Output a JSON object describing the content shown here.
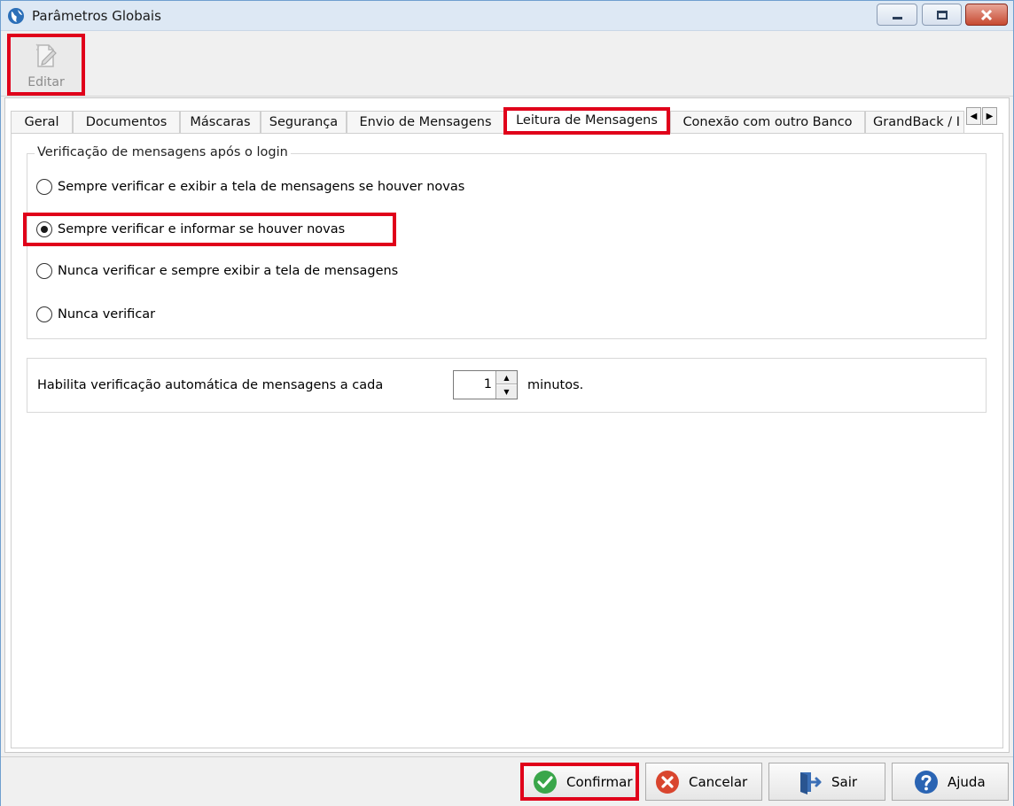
{
  "window": {
    "title": "Parâmetros Globais",
    "colors": {
      "highlight": "#e0001a",
      "titlebar": "#dde8f4"
    }
  },
  "toolbar": {
    "edit_label": "Editar"
  },
  "tabs": [
    {
      "label": "Geral"
    },
    {
      "label": "Documentos"
    },
    {
      "label": "Máscaras"
    },
    {
      "label": "Segurança"
    },
    {
      "label": "Envio de Mensagens"
    },
    {
      "label": "Leitura de Mensagens",
      "active": true
    },
    {
      "label": "Conexão com outro Banco"
    },
    {
      "label": "GrandBack / I"
    }
  ],
  "login_check": {
    "legend": "Verificação de mensagens após o login",
    "options": [
      {
        "label": "Sempre verificar e exibir a tela de mensagens se houver novas",
        "checked": false
      },
      {
        "label": "Sempre verificar e informar se houver novas",
        "checked": true
      },
      {
        "label": "Nunca verificar e sempre exibir a tela de mensagens",
        "checked": false
      },
      {
        "label": "Nunca verificar",
        "checked": false
      }
    ]
  },
  "auto_check": {
    "label": "Habilita verificação automática de mensagens a cada",
    "value": "1",
    "unit": "minutos."
  },
  "buttons": {
    "confirm": "Confirmar",
    "cancel": "Cancelar",
    "exit": "Sair",
    "help": "Ajuda"
  },
  "icons": {
    "app": "globe-icon",
    "edit": "edit-document-icon",
    "confirm": "check-circle-icon",
    "cancel": "x-circle-icon",
    "exit": "exit-door-icon",
    "help": "question-circle-icon"
  }
}
